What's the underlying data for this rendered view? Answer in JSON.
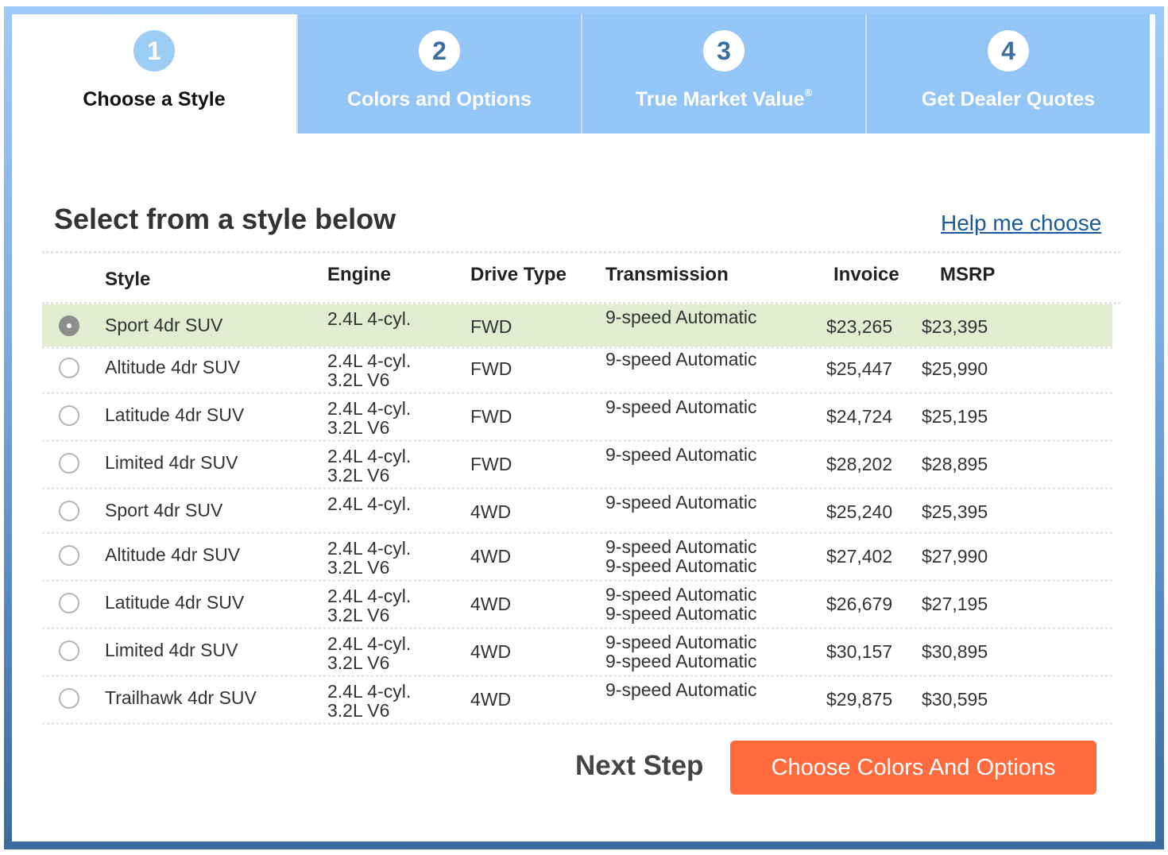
{
  "steps": [
    {
      "number": "1",
      "label": "Choose a Style",
      "active": true
    },
    {
      "number": "2",
      "label": "Colors and Options",
      "active": false
    },
    {
      "number": "3",
      "label": "True Market Value",
      "sup": "®",
      "active": false
    },
    {
      "number": "4",
      "label": "Get Dealer Quotes",
      "active": false
    }
  ],
  "heading": "Select from a style below",
  "help_link": "Help me choose",
  "columns": {
    "style": "Style",
    "engine": "Engine",
    "drive": "Drive Type",
    "transmission": "Transmission",
    "invoice": "Invoice",
    "msrp": "MSRP"
  },
  "rows": [
    {
      "style": "Sport 4dr SUV",
      "engine": [
        "2.4L 4-cyl."
      ],
      "drive": "FWD",
      "transmission": [
        "9-speed Automatic"
      ],
      "invoice": "$23,265",
      "msrp": "$23,395",
      "selected": true
    },
    {
      "style": "Altitude 4dr SUV",
      "engine": [
        "2.4L 4-cyl.",
        "3.2L V6"
      ],
      "drive": "FWD",
      "transmission": [
        "9-speed Automatic"
      ],
      "invoice": "$25,447",
      "msrp": "$25,990",
      "selected": false
    },
    {
      "style": "Latitude 4dr SUV",
      "engine": [
        "2.4L 4-cyl.",
        "3.2L V6"
      ],
      "drive": "FWD",
      "transmission": [
        "9-speed Automatic"
      ],
      "invoice": "$24,724",
      "msrp": "$25,195",
      "selected": false
    },
    {
      "style": "Limited 4dr SUV",
      "engine": [
        "2.4L 4-cyl.",
        "3.2L V6"
      ],
      "drive": "FWD",
      "transmission": [
        "9-speed Automatic"
      ],
      "invoice": "$28,202",
      "msrp": "$28,895",
      "selected": false
    },
    {
      "style": "Sport 4dr SUV",
      "engine": [
        "2.4L 4-cyl."
      ],
      "drive": "4WD",
      "transmission": [
        "9-speed Automatic"
      ],
      "invoice": "$25,240",
      "msrp": "$25,395",
      "selected": false
    },
    {
      "style": "Altitude 4dr SUV",
      "engine": [
        "2.4L 4-cyl.",
        "3.2L V6"
      ],
      "drive": "4WD",
      "transmission": [
        "9-speed Automatic",
        "9-speed Automatic"
      ],
      "invoice": "$27,402",
      "msrp": "$27,990",
      "selected": false
    },
    {
      "style": "Latitude 4dr SUV",
      "engine": [
        "2.4L 4-cyl.",
        "3.2L V6"
      ],
      "drive": "4WD",
      "transmission": [
        "9-speed Automatic",
        "9-speed Automatic"
      ],
      "invoice": "$26,679",
      "msrp": "$27,195",
      "selected": false
    },
    {
      "style": "Limited 4dr SUV",
      "engine": [
        "2.4L 4-cyl.",
        "3.2L V6"
      ],
      "drive": "4WD",
      "transmission": [
        "9-speed Automatic",
        "9-speed Automatic"
      ],
      "invoice": "$30,157",
      "msrp": "$30,895",
      "selected": false
    },
    {
      "style": "Trailhawk 4dr SUV",
      "engine": [
        "2.4L 4-cyl.",
        "3.2L V6"
      ],
      "drive": "4WD",
      "transmission": [
        "9-speed Automatic"
      ],
      "invoice": "$29,875",
      "msrp": "$30,595",
      "selected": false
    }
  ],
  "footer": {
    "next_step_label": "Next Step",
    "cta_label": "Choose Colors And Options"
  },
  "colors": {
    "selected_row": "#e1ecd1",
    "cta": "#ff6b3d",
    "step_inactive": "#93c5f6",
    "link": "#1a5a96"
  }
}
